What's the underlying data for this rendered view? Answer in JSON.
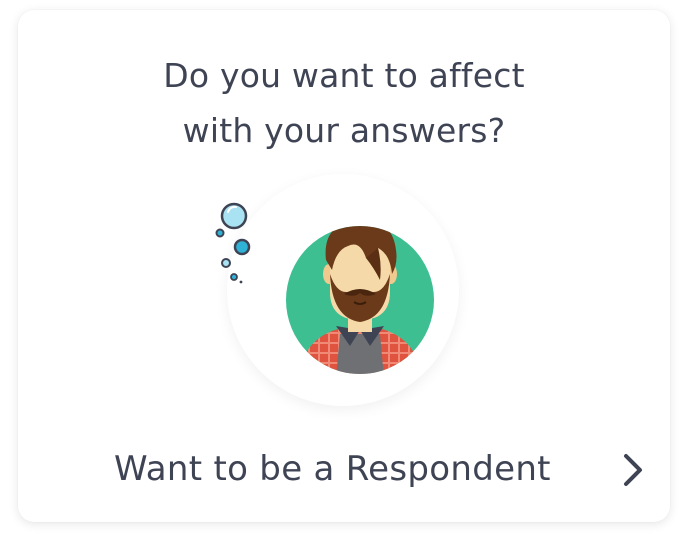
{
  "card": {
    "question_line1": "Do you want to affect",
    "question_line2": "with your answers?",
    "cta_label": "Want to be a Respondent"
  },
  "icons": {
    "avatar": "bearded-man-avatar",
    "bubbles": "bubbles-decoration",
    "chevron": "chevron-right-icon"
  },
  "colors": {
    "text": "#3f4455",
    "avatar_bg": "#3dbf92",
    "bubble_blue": "#56c8e6",
    "shirt_red": "#e0533f"
  }
}
